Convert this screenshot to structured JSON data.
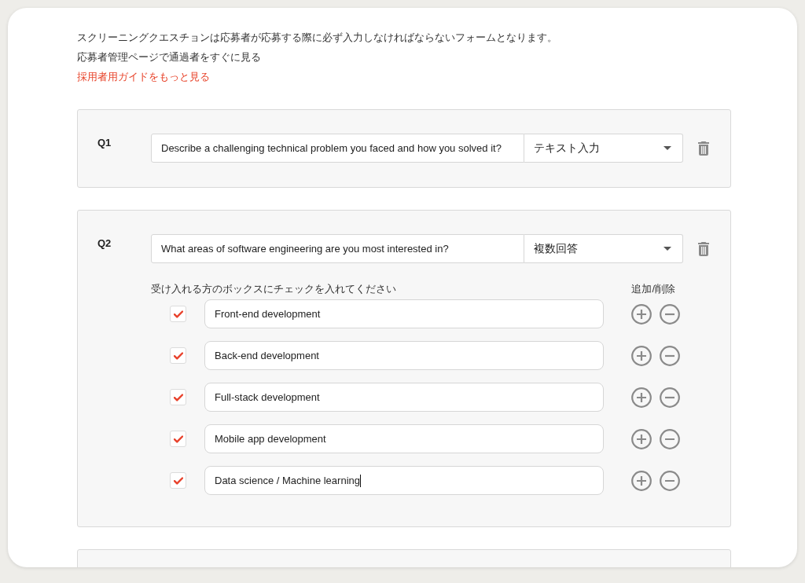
{
  "intro": {
    "description": "スクリーニングクエスチョンは応募者が応募する際に必ず入力しなければならないフォームとなります。",
    "applicants_link": "応募者管理ページで通過者をすぐに見る",
    "guide_link": "採用者用ガイドをもっと見る"
  },
  "questions": [
    {
      "kind": "text",
      "label": "Q1",
      "question": "Describe a challenging technical problem you faced and how you solved it?",
      "answer_type": "テキスト入力"
    },
    {
      "kind": "multiple_choice",
      "label": "Q2",
      "question": "What areas of software engineering are you most interested in?",
      "answer_type": "複数回答",
      "options_hint": "受け入れる方のボックスにチェックを入れてください",
      "actions_heading": "追加/削除",
      "options": [
        {
          "text": "Front-end development",
          "checked": true,
          "focused": false
        },
        {
          "text": "Back-end development",
          "checked": true,
          "focused": false
        },
        {
          "text": "Full-stack development",
          "checked": true,
          "focused": false
        },
        {
          "text": "Mobile app development",
          "checked": true,
          "focused": false
        },
        {
          "text": "Data science / Machine learning",
          "checked": true,
          "focused": true
        }
      ]
    }
  ]
}
